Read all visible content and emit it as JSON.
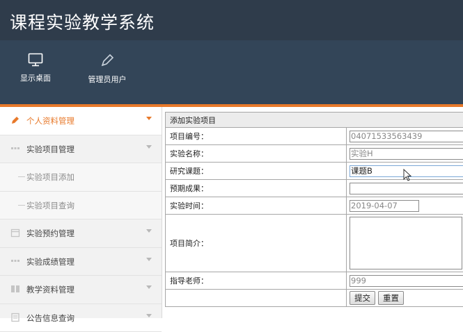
{
  "app": {
    "title": "课程实验教学系统"
  },
  "toolbar": [
    {
      "label": "显示桌面",
      "icon": "monitor-icon"
    },
    {
      "label": "管理员用户",
      "icon": "pencil-icon"
    }
  ],
  "sidebar": {
    "items": [
      {
        "label": "个人资料管理",
        "icon": "pencil-icon",
        "active": true
      },
      {
        "label": "实验项目管理",
        "icon": "grid-icon"
      },
      {
        "label": "实验项目添加",
        "sub": true
      },
      {
        "label": "实验项目查询",
        "sub": true
      },
      {
        "label": "实验预约管理",
        "icon": "calendar-icon"
      },
      {
        "label": "实验成绩管理",
        "icon": "grid-icon"
      },
      {
        "label": "教学资料管理",
        "icon": "book-icon"
      },
      {
        "label": "公告信息查询",
        "icon": "document-icon"
      }
    ]
  },
  "form": {
    "title": "添加实验项目",
    "fields": {
      "project_no": {
        "label": "项目编号：",
        "value": "04071533563439"
      },
      "name": {
        "label": "实验名称：",
        "value": "实验H"
      },
      "topic": {
        "label": "研究课题：",
        "value": "课题B"
      },
      "outcome": {
        "label": "预期成果：",
        "value": ""
      },
      "date": {
        "label": "实验时间：",
        "value": "2019-04-07"
      },
      "intro": {
        "label": "项目简介：",
        "value": ""
      },
      "teacher": {
        "label": "指导老师：",
        "value": "999"
      }
    },
    "submit_label": "提交",
    "reset_label": "重置"
  },
  "colors": {
    "topbar": "#2f3c4b",
    "toolbar": "#334558",
    "accent": "#e8792a",
    "sidebar": "#f2f2f2"
  }
}
